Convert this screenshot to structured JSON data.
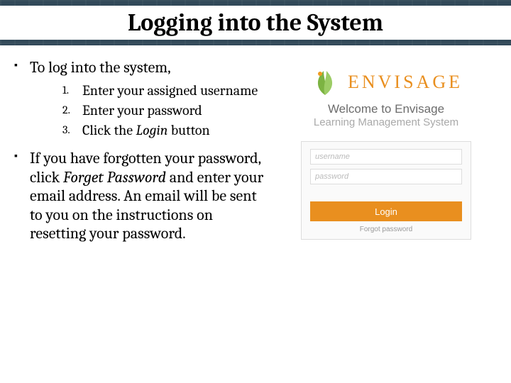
{
  "title": "Logging into the System",
  "left": {
    "bullet1": "To log into the system,",
    "steps": {
      "s1": "Enter your assigned username",
      "s2": "Enter your password",
      "s3_pre": "Click the ",
      "s3_em": "Login",
      "s3_post": " button"
    },
    "bullet2_pre": "If you have forgotten your password, click ",
    "bullet2_em": "Forget Password",
    "bullet2_post": " and enter your email address. An email will be sent to you on the instructions on resetting your password."
  },
  "right": {
    "brand": "ENVISAGE",
    "welcome_line1": "Welcome to Envisage",
    "welcome_line2": "Learning Management System",
    "login": {
      "username_ph": "username",
      "password_ph": "password",
      "button_label": "Login",
      "forgot_label": "Forgot password"
    }
  }
}
